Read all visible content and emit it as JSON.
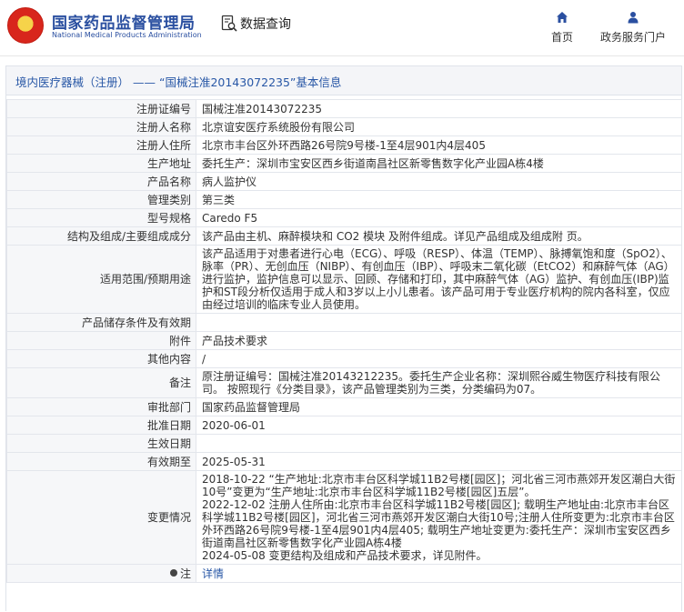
{
  "header": {
    "logo_cn": "国家药品监督管理局",
    "logo_en": "National Medical Products Administration",
    "search_label": "数据查询",
    "nav": [
      {
        "label": "首页",
        "icon": "home-icon"
      },
      {
        "label": "政务服务门户",
        "icon": "user-icon"
      }
    ],
    "colors": {
      "brand": "#2a4fa0",
      "emblem_red": "#d8261c",
      "emblem_gold": "#f6d34a"
    }
  },
  "breadcrumb": {
    "section": "境内医疗器械（注册）",
    "separator": " —— ",
    "title": "“国械注准20143072235”基本信息"
  },
  "rows": [
    {
      "label": "注册证编号",
      "value": "国械注准20143072235"
    },
    {
      "label": "注册人名称",
      "value": "北京谊安医疗系统股份有限公司"
    },
    {
      "label": "注册人住所",
      "value": "北京市丰台区外环西路26号院9号楼-1至4层901内4层405"
    },
    {
      "label": "生产地址",
      "value": "委托生产：深圳市宝安区西乡街道南昌社区新零售数字化产业园A栋4楼"
    },
    {
      "label": "产品名称",
      "value": "病人监护仪"
    },
    {
      "label": "管理类别",
      "value": "第三类"
    },
    {
      "label": "型号规格",
      "value": "Caredo F5"
    },
    {
      "label": "结构及组成/主要组成成分",
      "value": "该产品由主机、麻醉模块和 CO2 模块 及附件组成。详见产品组成及组成附 页。"
    },
    {
      "label": "适用范围/预期用途",
      "value": "该产品适用于对患者进行心电（ECG）、呼吸（RESP）、体温（TEMP）、脉搏氧饱和度（SpO2）、脉率（PR）、无创血压（NIBP）、有创血压（IBP）、呼吸末二氧化碳（EtCO2）和麻醉气体（AG）进行监护，监护信息可以显示、回顾、存储和打印，其中麻醉气体（AG）监护、有创血压(IBP)监护和ST段分析仅适用于成人和3岁以上小儿患者。该产品可用于专业医疗机构的院内各科室，仅应由经过培训的临床专业人员使用。"
    },
    {
      "label": "产品储存条件及有效期",
      "value": ""
    },
    {
      "label": "附件",
      "value": "产品技术要求"
    },
    {
      "label": "其他内容",
      "value": "/"
    },
    {
      "label": "备注",
      "value": "原注册证编号：国械注准20143212235。委托生产企业名称：深圳熙谷威生物医疗科技有限公司。 按照现行《分类目录》，该产品管理类别为三类，分类编码为07。"
    },
    {
      "label": "审批部门",
      "value": "国家药品监督管理局"
    },
    {
      "label": "批准日期",
      "value": "2020-06-01"
    },
    {
      "label": "生效日期",
      "value": ""
    },
    {
      "label": "有效期至",
      "value": "2025-05-31"
    }
  ],
  "changes": {
    "label": "变更情况",
    "lines": [
      "2018-10-22 “生产地址:北京市丰台区科学城11B2号楼[园区]；河北省三河市燕郊开发区潮白大街10号”变更为“生产地址:北京市丰台区科学城11B2号楼[园区]五层”。",
      "2022-12-02 注册人住所由:北京市丰台区科学城11B2号楼[园区]; 载明生产地址由:北京市丰台区科学城11B2号楼[园区]，河北省三河市燕郊开发区潮白大街10号;注册人住所变更为:北京市丰台区外环西路26号院9号楼-1至4层901内4层405; 载明生产地址变更为:委托生产：深圳市宝安区西乡街道南昌社区新零售数字化产业园A栋4楼",
      "2024-05-08 变更结构及组成和产品技术要求，详见附件。"
    ]
  },
  "note": {
    "label": "注",
    "link": "详情"
  }
}
